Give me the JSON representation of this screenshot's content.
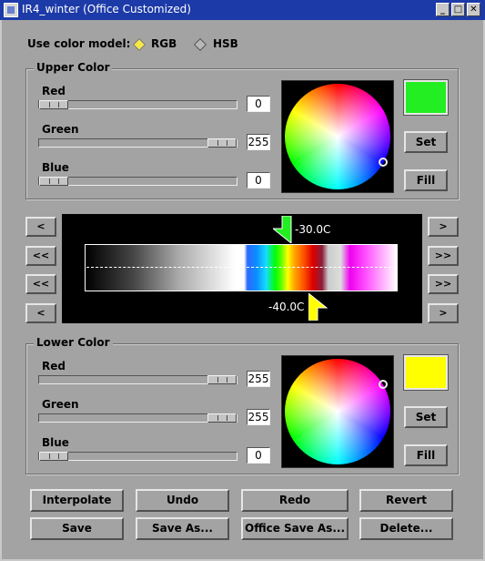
{
  "window": {
    "title": "IR4_winter (Office Customized)",
    "min": "_",
    "max": "□",
    "close": "✕"
  },
  "color_model": {
    "label": "Use color model:",
    "options": [
      "RGB",
      "HSB"
    ],
    "selected": "RGB"
  },
  "upper": {
    "title": "Upper Color",
    "sliders": [
      {
        "name": "Red",
        "value": "0",
        "level": 0
      },
      {
        "name": "Green",
        "value": "255",
        "level": 1
      },
      {
        "name": "Blue",
        "value": "0",
        "level": 0
      }
    ],
    "swatch": "#22ee22",
    "set": "Set",
    "fill": "Fill"
  },
  "lower": {
    "title": "Lower Color",
    "sliders": [
      {
        "name": "Red",
        "value": "255",
        "level": 1
      },
      {
        "name": "Green",
        "value": "255",
        "level": 1
      },
      {
        "name": "Blue",
        "value": "0",
        "level": 0
      }
    ],
    "swatch": "#ffff00",
    "set": "Set",
    "fill": "Fill"
  },
  "colormap": {
    "upper_marker": "-30.0C",
    "lower_marker": "-40.0C",
    "left_buttons": [
      "<",
      "<<",
      "<<",
      "<"
    ],
    "right_buttons": [
      ">",
      ">>",
      ">>",
      ">"
    ]
  },
  "actions": {
    "row1": [
      "Interpolate",
      "Undo",
      "Redo",
      "Revert"
    ],
    "row2": [
      "Save",
      "Save As...",
      "Office Save As...",
      "Delete..."
    ]
  }
}
